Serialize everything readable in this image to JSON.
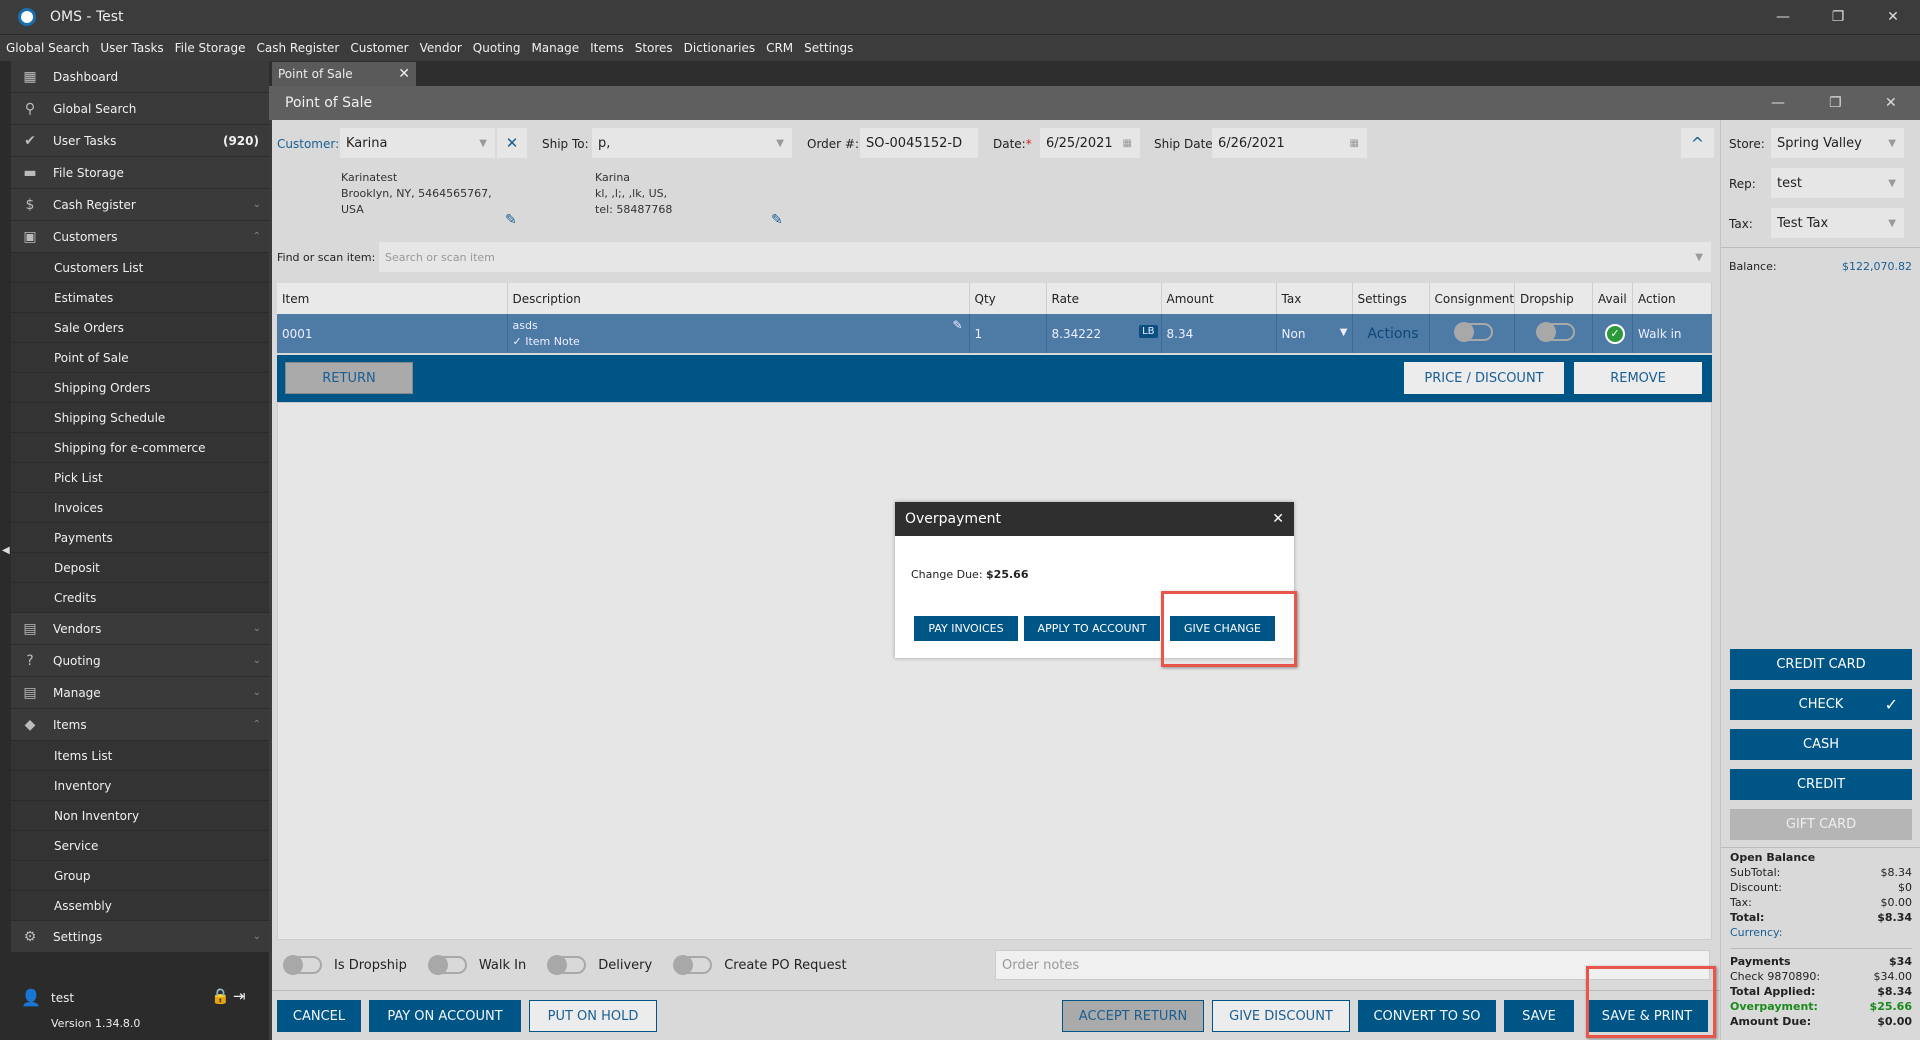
{
  "window": {
    "title": "OMS - Test",
    "minimize": "—",
    "restore": "❐",
    "close": "✕"
  },
  "menu": [
    "Global Search",
    "User Tasks",
    "File Storage",
    "Cash Register",
    "Customer",
    "Vendor",
    "Quoting",
    "Manage",
    "Items",
    "Stores",
    "Dictionaries",
    "CRM",
    "Settings"
  ],
  "sidebar": {
    "items": [
      {
        "label": "Dashboard",
        "icon": "▦",
        "type": "top"
      },
      {
        "label": "Global Search",
        "icon": "⚲",
        "type": "top"
      },
      {
        "label": "User Tasks",
        "icon": "✔",
        "type": "top",
        "count": "(920)"
      },
      {
        "label": "File Storage",
        "icon": "▬",
        "type": "top"
      },
      {
        "label": "Cash Register",
        "icon": "$",
        "type": "top",
        "chev": "⌄"
      },
      {
        "label": "Customers",
        "icon": "▣",
        "type": "top",
        "chev": "⌃"
      },
      {
        "label": "Customers List",
        "type": "sub"
      },
      {
        "label": "Estimates",
        "type": "sub"
      },
      {
        "label": "Sale Orders",
        "type": "sub"
      },
      {
        "label": "Point of Sale",
        "type": "sub"
      },
      {
        "label": "Shipping Orders",
        "type": "sub"
      },
      {
        "label": "Shipping Schedule",
        "type": "sub"
      },
      {
        "label": "Shipping for e-commerce",
        "type": "sub"
      },
      {
        "label": "Pick List",
        "type": "sub"
      },
      {
        "label": "Invoices",
        "type": "sub"
      },
      {
        "label": "Payments",
        "type": "sub"
      },
      {
        "label": "Deposit",
        "type": "sub"
      },
      {
        "label": "Credits",
        "type": "sub"
      },
      {
        "label": "Vendors",
        "icon": "▤",
        "type": "top",
        "chev": "⌄"
      },
      {
        "label": "Quoting",
        "icon": "?",
        "type": "top",
        "chev": "⌄"
      },
      {
        "label": "Manage",
        "icon": "▤",
        "type": "top",
        "chev": "⌄"
      },
      {
        "label": "Items",
        "icon": "◆",
        "type": "top",
        "chev": "⌃"
      },
      {
        "label": "Items List",
        "type": "sub"
      },
      {
        "label": "Inventory",
        "type": "sub"
      },
      {
        "label": "Non Inventory",
        "type": "sub"
      },
      {
        "label": "Service",
        "type": "sub"
      },
      {
        "label": "Group",
        "type": "sub"
      },
      {
        "label": "Assembly",
        "type": "sub"
      },
      {
        "label": "Settings",
        "icon": "⚙",
        "type": "top",
        "chev": "⌄"
      }
    ],
    "user": "test",
    "version": "Version 1.34.8.0"
  },
  "tab": {
    "label": "Point of Sale",
    "close": "✕"
  },
  "panel_title": "Point of Sale",
  "header": {
    "customer_label": "Customer:",
    "customer": "Karina",
    "clear": "✕",
    "shipto_label": "Ship To:",
    "shipto": "p,",
    "order_label": "Order #:",
    "order": "SO-0045152-D",
    "date_label": "Date:",
    "required": "*",
    "date": "6/25/2021",
    "shipdate_label": "Ship Date:",
    "shipdate": "6/26/2021",
    "collapse": "^"
  },
  "bill_address": [
    "Karinatest",
    "Brooklyn, NY, 5464565767,",
    "USA"
  ],
  "ship_address": [
    "Karina",
    "kl, ,l;, ,lk, US,",
    "tel: 58487768"
  ],
  "find": {
    "label": "Find or scan item:",
    "placeholder": "Search or scan item"
  },
  "table": {
    "columns": [
      "Item",
      "Description",
      "Qty",
      "Rate",
      "Amount",
      "Tax",
      "Settings",
      "Consignment",
      "Dropship",
      "Avail",
      "Action"
    ],
    "row": {
      "item": "0001",
      "description": "asds",
      "note": "✓ Item Note",
      "qty": "1",
      "rate": "8.34222",
      "unit": "LB",
      "amount": "8.34",
      "tax": "Non",
      "settings": "Actions",
      "action": "Walk in"
    }
  },
  "row_actions": {
    "return": "RETURN",
    "price_discount": "PRICE / DISCOUNT",
    "remove": "REMOVE"
  },
  "toggles": [
    "Is Dropship",
    "Walk In",
    "Delivery",
    "Create PO Request"
  ],
  "order_notes_placeholder": "Order notes",
  "footer": {
    "cancel": "CANCEL",
    "pay_on_account": "PAY ON ACCOUNT",
    "put_on_hold": "PUT ON HOLD",
    "accept_return": "ACCEPT RETURN",
    "give_discount": "GIVE DISCOUNT",
    "convert_to_so": "CONVERT TO SO",
    "save": "SAVE",
    "save_print": "SAVE & PRINT"
  },
  "right": {
    "store_label": "Store:",
    "store": "Spring Valley",
    "rep_label": "Rep:",
    "rep": "test",
    "tax_label": "Tax:",
    "tax": "Test Tax",
    "balance_label": "Balance:",
    "balance": "$122,070.82",
    "payment_buttons": [
      "CREDIT CARD",
      "CHECK",
      "CASH",
      "CREDIT",
      "GIFT CARD"
    ],
    "open_balance": "Open Balance",
    "summary": [
      {
        "label": "SubTotal:",
        "value": "$8.34"
      },
      {
        "label": "Discount:",
        "value": "$0"
      },
      {
        "label": "Tax:",
        "value": "$0.00"
      },
      {
        "label": "Total:",
        "value": "$8.34",
        "bold": true
      }
    ],
    "currency_label": "Currency:",
    "payments": [
      {
        "label": "Payments",
        "value": "$34",
        "bold": true
      },
      {
        "label": "Check 9870890:",
        "value": "$34.00"
      },
      {
        "label": "Total Applied:",
        "value": "$8.34",
        "bold": true
      },
      {
        "label": "Overpayment:",
        "value": "$25.66",
        "bold": true,
        "green": true
      },
      {
        "label": "Amount Due:",
        "value": "$0.00",
        "bold": true
      }
    ]
  },
  "dialog": {
    "title": "Overpayment",
    "close": "✕",
    "change_label": "Change Due:",
    "change_value": "$25.66",
    "pay_invoices": "PAY INVOICES",
    "apply_to_account": "APPLY TO ACCOUNT",
    "give_change": "GIVE CHANGE"
  },
  "colors": {
    "primary": "#005587",
    "row": "#4d7ba6",
    "highlight": "#e8554b",
    "green": "#1a8a1a"
  }
}
